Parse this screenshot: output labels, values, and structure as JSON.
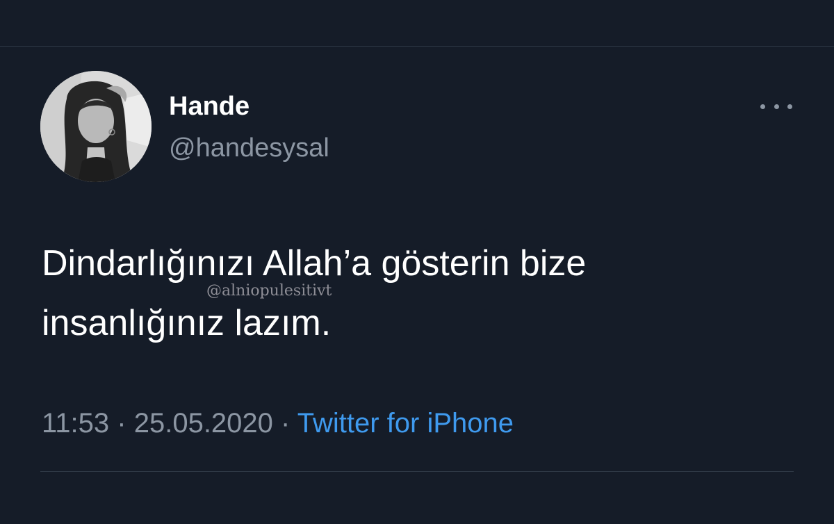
{
  "tweet": {
    "author": {
      "display_name": "Hande",
      "handle": "@handesysal",
      "avatar": "grayscale-portrait"
    },
    "more_icon": "ellipsis-icon",
    "text_lines": [
      "Dindarlığınızı Allah’a gösterin bize",
      "insanlığınız lazım."
    ],
    "watermark": "@alniopulesitivt",
    "time": "11:53",
    "separator": "·",
    "date": "25.05.2020",
    "source": "Twitter for iPhone"
  },
  "colors": {
    "background": "#151c28",
    "divider": "#2f3946",
    "primary_text": "#ffffff",
    "secondary_text": "#8c96a3",
    "link": "#3f9aee"
  }
}
